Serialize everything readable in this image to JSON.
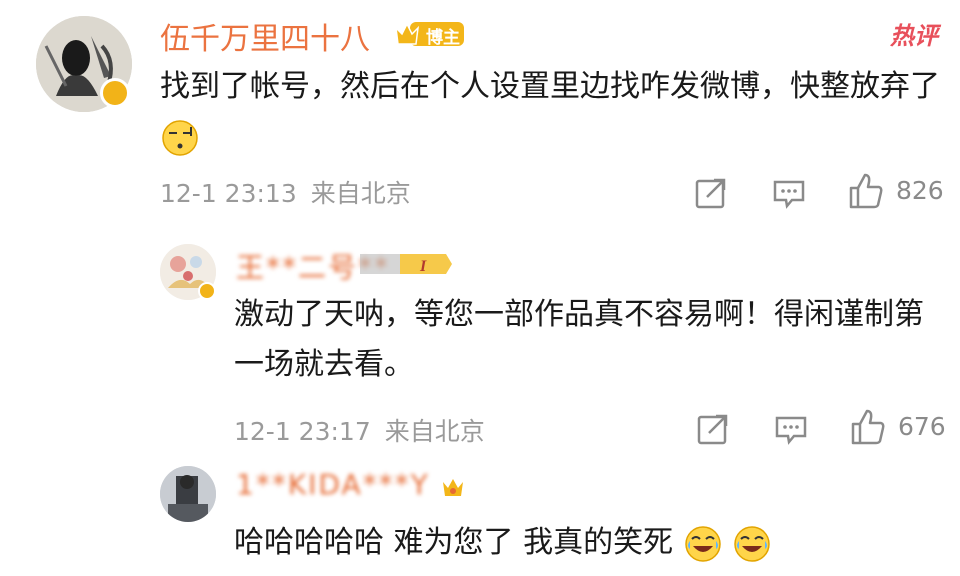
{
  "hot_label": "热评",
  "comments": [
    {
      "name": "伍千万里四十八",
      "badge": "博主",
      "text": "找到了帐号，然后在个人设置里边找咋发微博，快整放弃了",
      "time": "12-1 23:13",
      "source": "来自北京",
      "likes": "826"
    },
    {
      "name": "王**二号**",
      "text": "激动了天呐，等您一部作品真不容易啊！得闲谨制第一场就去看。",
      "time": "12-1 23:17",
      "source": "来自北京",
      "likes": "676"
    },
    {
      "name": "1**KIDA***Y",
      "text": "哈哈哈哈哈 难为您了 我真的笑死"
    }
  ],
  "colors": {
    "name": "#eb7340",
    "badge_bg": "#f3b619",
    "hot": "#e8505b",
    "meta": "#9a9a9a"
  },
  "icons": [
    "share-icon",
    "comment-icon",
    "like-icon",
    "emoji-speechless-icon",
    "emoji-laugh-cry-icon",
    "verified-icon"
  ]
}
